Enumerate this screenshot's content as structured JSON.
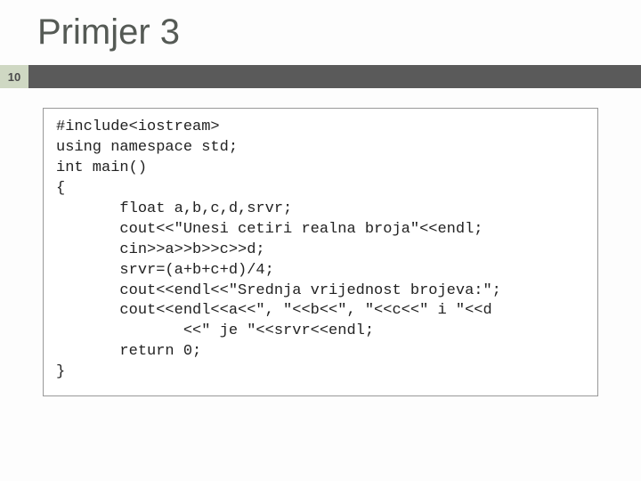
{
  "title": "Primjer 3",
  "page_number": "10",
  "code": "#include<iostream>\nusing namespace std;\nint main()\n{\n       float a,b,c,d,srvr;\n       cout<<\"Unesi cetiri realna broja\"<<endl;\n       cin>>a>>b>>c>>d;\n       srvr=(a+b+c+d)/4;\n       cout<<endl<<\"Srednja vrijednost brojeva:\";\n       cout<<endl<<a<<\", \"<<b<<\", \"<<c<<\" i \"<<d\n              <<\" je \"<<srvr<<endl;\n       return 0;\n}"
}
